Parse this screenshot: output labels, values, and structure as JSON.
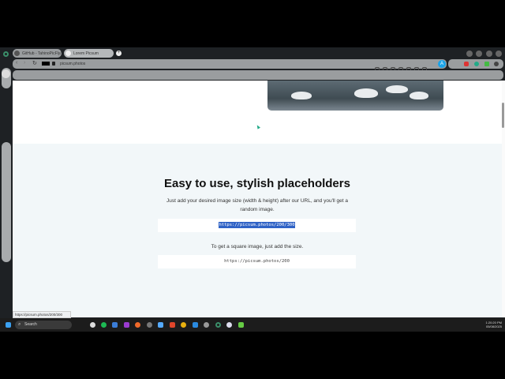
{
  "browser": {
    "tabs": [
      {
        "label": "GitHub - TahinoPicFly/..."
      },
      {
        "label": "Lorem Picsum"
      }
    ],
    "new_tab": "+",
    "address": "picsum.photos",
    "profile_badge": "A"
  },
  "page": {
    "heading": "Easy to use, stylish placeholders",
    "intro": "Just add your desired image size (width & height) after our URL, and you'll get a random image.",
    "example1": "https://picsum.photos/200/300",
    "square_text": "To get a square image, just add the size.",
    "example2": "https://picsum.photos/200"
  },
  "status_url": "https://picsum.photos/200/300",
  "taskbar": {
    "search": "Search",
    "time": "1:20:20 PM",
    "date": "05/08/2025"
  },
  "colors": {
    "section_bg": "#f2f7f9",
    "selection": "#2f62c6",
    "accent": "#1aa3e8"
  }
}
